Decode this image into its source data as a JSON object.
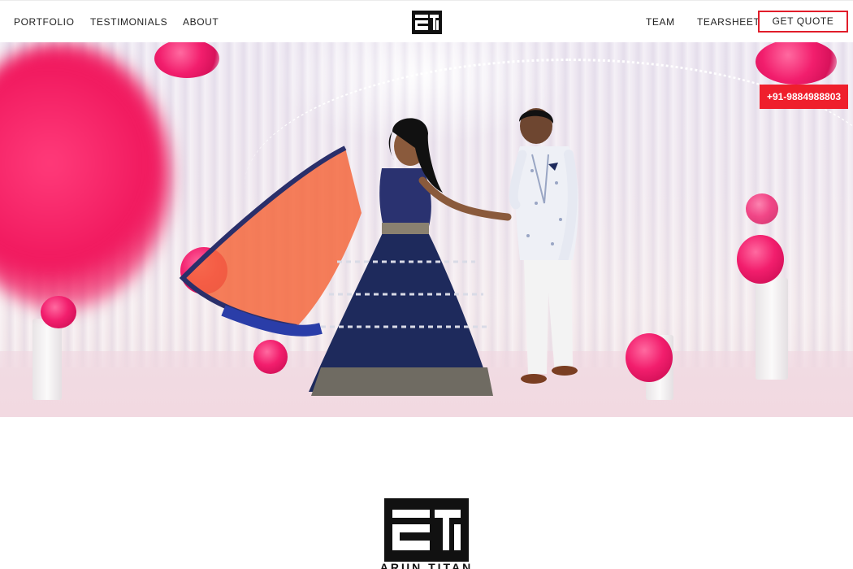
{
  "nav": {
    "left_links": [
      "PORTFOLIO",
      "TESTIMONIALS",
      "ABOUT"
    ],
    "right_links": [
      "TEAM",
      "TEARSHEET"
    ],
    "quote_button": "GET QUOTE",
    "logo_icon": "brand-logo-icon"
  },
  "hero": {
    "phone_button": "+91-9884988803",
    "image_alt_icon": "wedding-couple-dance-photo"
  },
  "about": {
    "logo_icon": "brand-logo-icon",
    "brand_name": "ARUN TITAN"
  },
  "colors": {
    "accent_red": "#ef1f2c",
    "quote_border": "#e11d2a",
    "text": "#222222",
    "logo_black": "#111111"
  }
}
